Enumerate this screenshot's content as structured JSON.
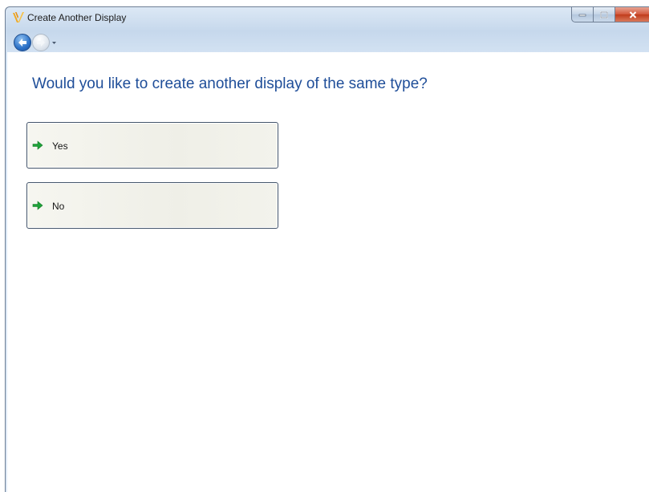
{
  "window": {
    "title": "Create Another Display",
    "icon": "app-v-icon"
  },
  "caption_buttons": {
    "minimize_icon": "minimize-icon",
    "maximize_icon": "maximize-icon",
    "close_icon": "close-icon"
  },
  "navigation": {
    "back_icon": "back-arrow-icon",
    "forward_icon": "forward-arrow-icon",
    "dropdown_icon": "chevron-down-icon"
  },
  "main": {
    "heading": "Would you like to create another display of the same type?",
    "options": [
      {
        "label": "Yes",
        "icon": "green-arrow-icon"
      },
      {
        "label": "No",
        "icon": "green-arrow-icon"
      }
    ]
  },
  "colors": {
    "heading": "#1f4e99",
    "arrow": "#1fa23a",
    "close_button": "#c8452a"
  }
}
